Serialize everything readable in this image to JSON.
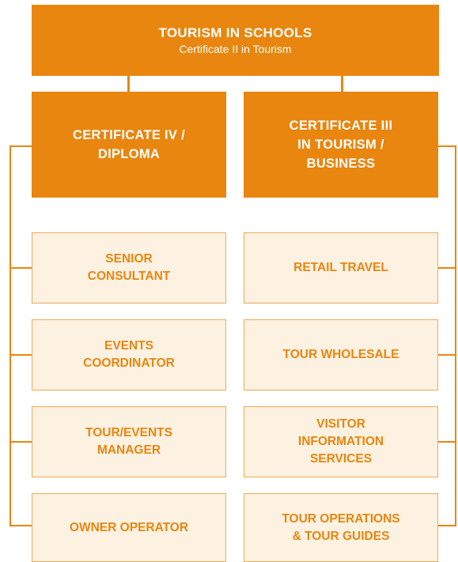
{
  "top": {
    "title": "TOURISM IN SCHOOLS",
    "subtitle": "Certificate II in Tourism"
  },
  "left": {
    "title": "CERTIFICATE IV /\nDIPLOMA",
    "items": [
      "SENIOR\nCONSULTANT",
      "EVENTS\nCOORDINATOR",
      "TOUR/EVENTS\nMANAGER",
      "OWNER OPERATOR"
    ]
  },
  "right": {
    "title": "CERTIFICATE III\nIN TOURISM /\nBUSINESS",
    "items": [
      "RETAIL TRAVEL",
      "TOUR WHOLESALE",
      "VISITOR\nINFORMATION\nSERVICES",
      "TOUR OPERATIONS\n& TOUR GUIDES"
    ]
  },
  "colors": {
    "accent": "#e8860f",
    "light_fill": "#fdf1e1"
  }
}
